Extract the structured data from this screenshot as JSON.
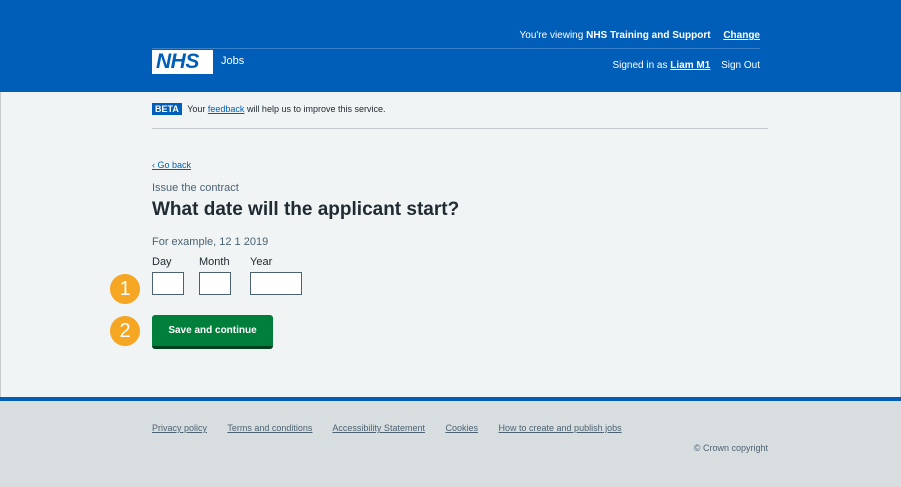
{
  "header": {
    "viewing_prefix": "You're viewing",
    "organisation": "NHS Training and Support",
    "change_label": "Change",
    "logo_text": "NHS",
    "service_name": "Jobs",
    "signed_in_prefix": "Signed in as",
    "user_name": "Liam M1",
    "sign_out_label": "Sign Out"
  },
  "beta_banner": {
    "tag": "BETA",
    "prefix": "Your",
    "link": "feedback",
    "suffix": "will help us to improve this service."
  },
  "back_link": "Go back",
  "caption": "Issue the contract",
  "heading": "What date will the applicant start?",
  "hint": "For example, 12 1 2019",
  "date_fields": {
    "day": {
      "label": "Day",
      "value": ""
    },
    "month": {
      "label": "Month",
      "value": ""
    },
    "year": {
      "label": "Year",
      "value": ""
    }
  },
  "submit_label": "Save and continue",
  "badges": [
    "1",
    "2"
  ],
  "badge_color": "#f5a623",
  "brand_color": "#005eb8",
  "button_color": "#007f3b",
  "footer": {
    "links": [
      "Privacy policy",
      "Terms and conditions",
      "Accessibility Statement",
      "Cookies",
      "How to create and publish jobs"
    ],
    "copyright": "© Crown copyright"
  }
}
